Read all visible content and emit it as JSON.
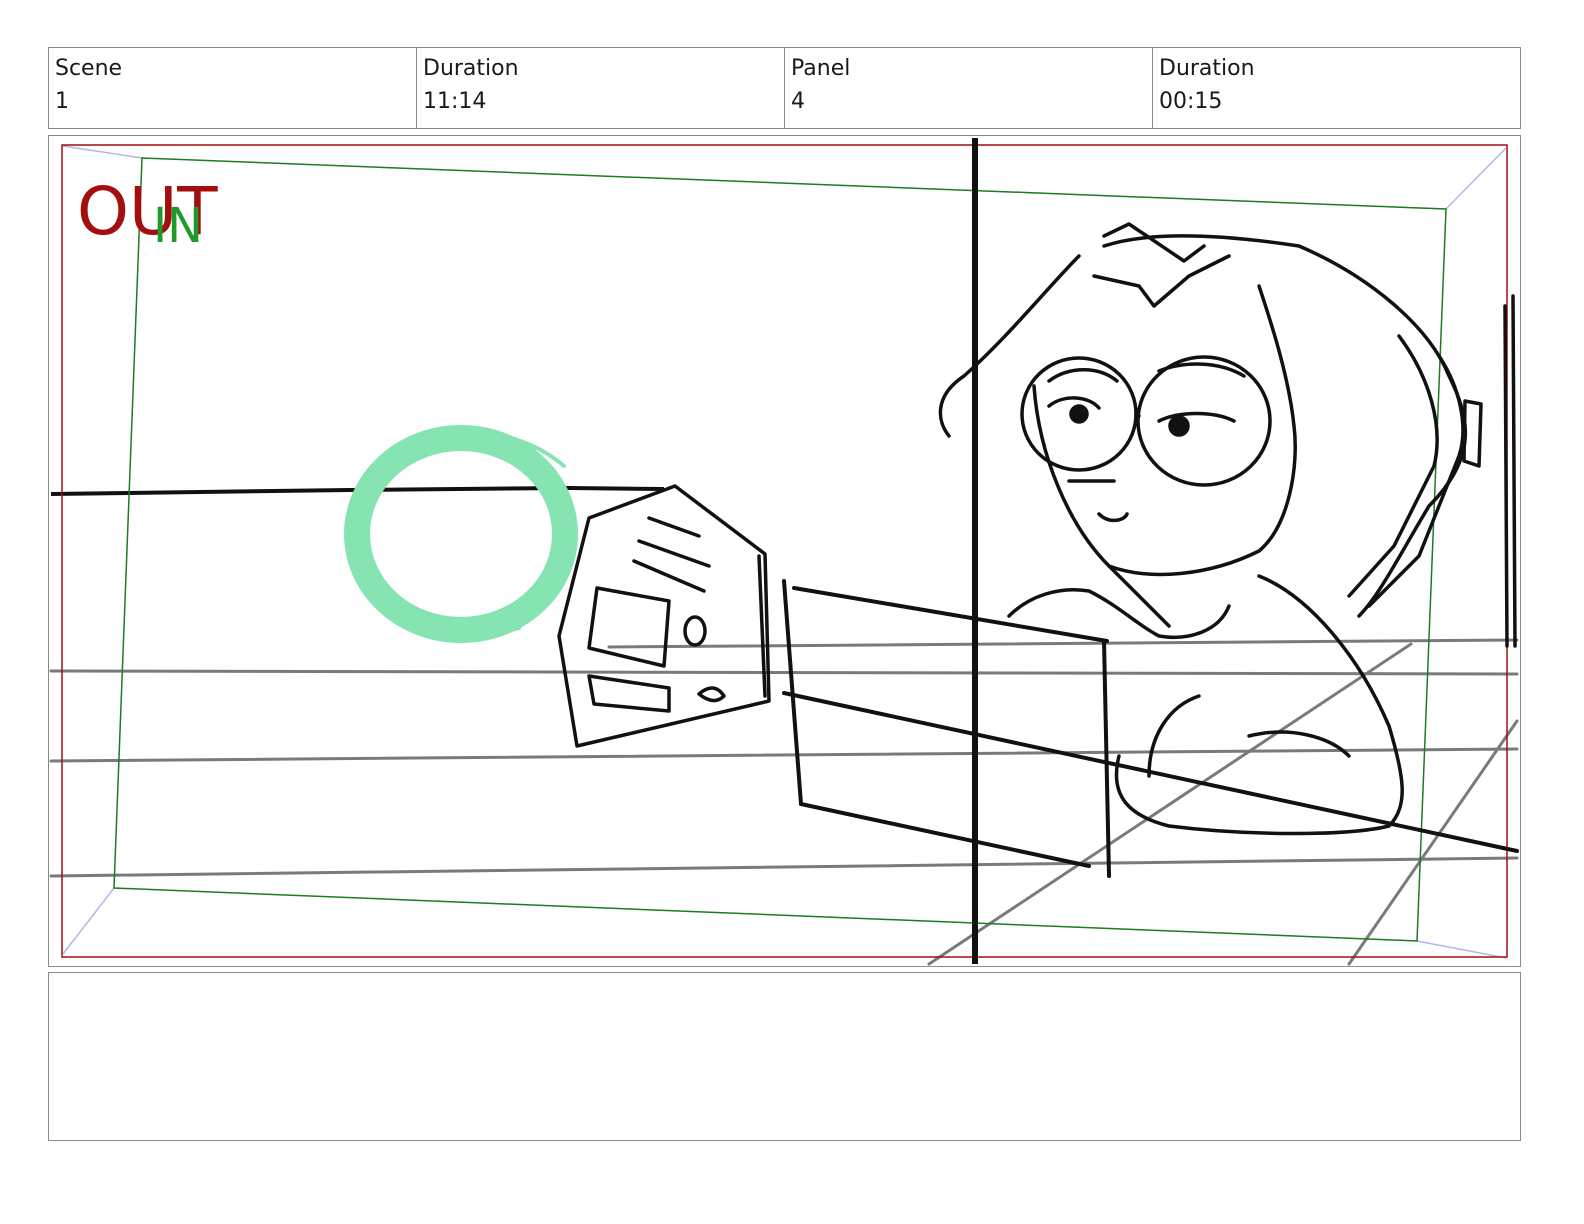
{
  "header": {
    "scene_label": "Scene",
    "scene_value": "1",
    "scene_duration_label": "Duration",
    "scene_duration_value": "11:14",
    "panel_label": "Panel",
    "panel_value": "4",
    "panel_duration_label": "Duration",
    "panel_duration_value": "00:15"
  },
  "frame": {
    "out_label": "OUT",
    "in_label": "IN",
    "out_color": "#a30f0f",
    "in_color": "#1f9a2a",
    "guide_color": "#b9b4e8",
    "marker_color": "#86e4b3"
  },
  "notes": {
    "text": ""
  }
}
